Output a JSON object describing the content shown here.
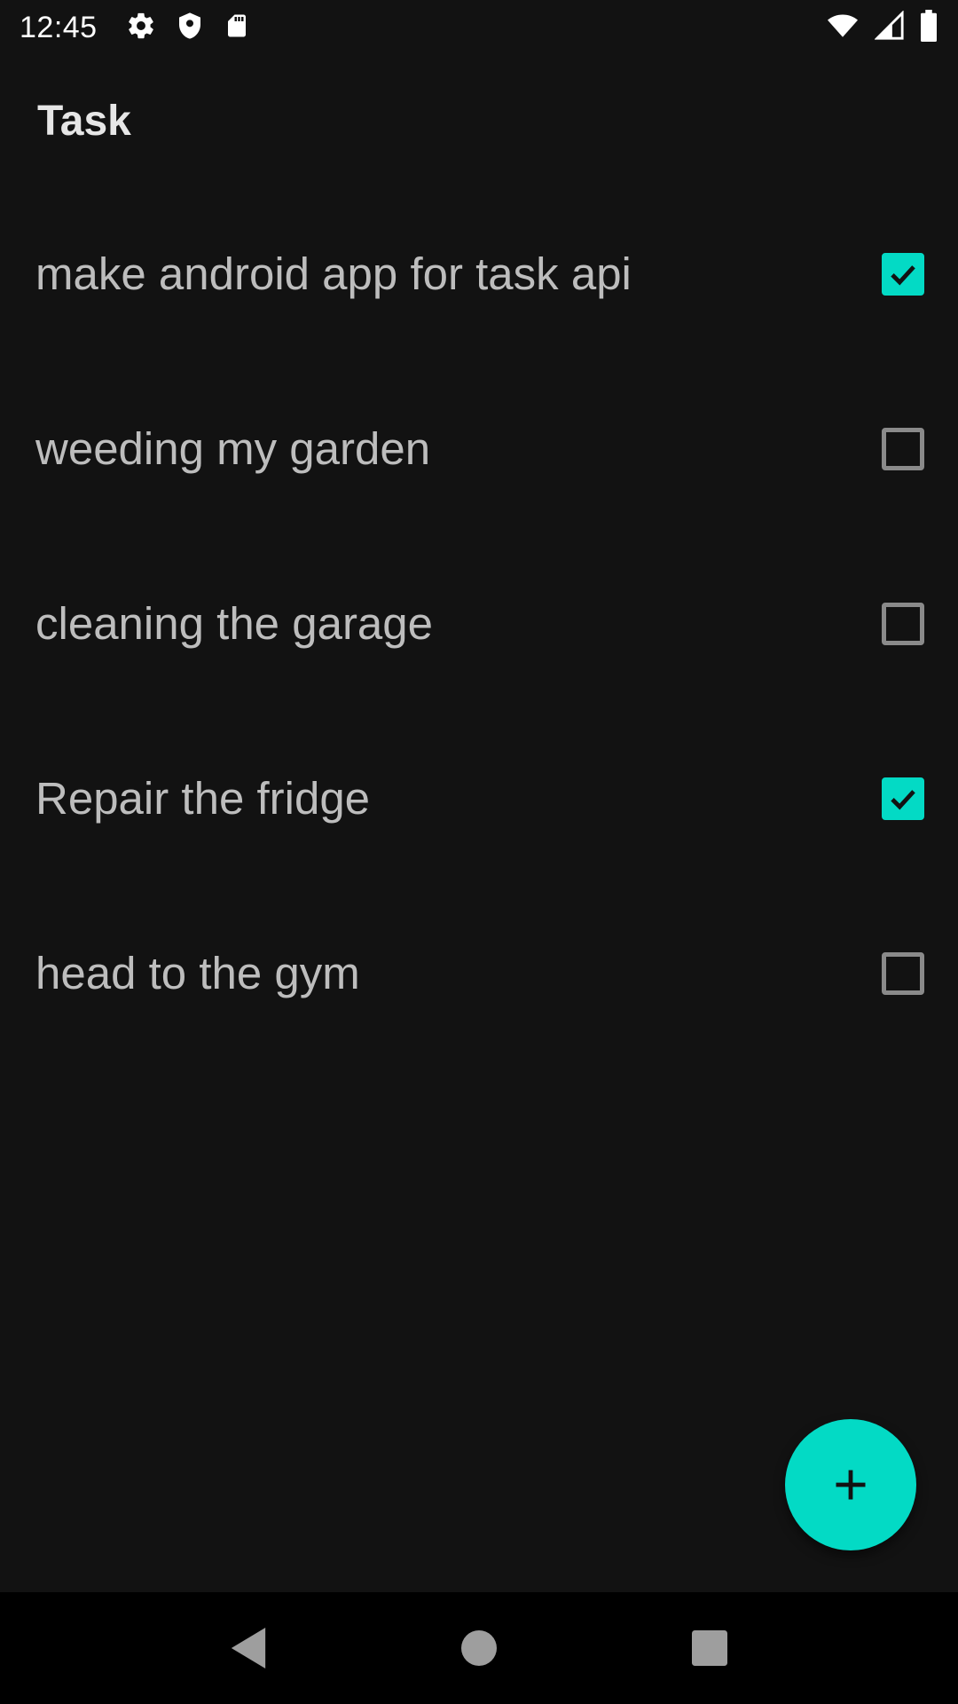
{
  "status_bar": {
    "time": "12:45",
    "left_icons": [
      "gear-icon",
      "shield-icon",
      "sd-card-icon"
    ],
    "right_icons": [
      "wifi-icon",
      "signal-icon",
      "battery-icon"
    ]
  },
  "app_bar": {
    "title": "Task"
  },
  "tasks": [
    {
      "label": "make android app for task api",
      "checked": true
    },
    {
      "label": "weeding my garden",
      "checked": false
    },
    {
      "label": "cleaning the garage",
      "checked": false
    },
    {
      "label": "Repair the fridge",
      "checked": true
    },
    {
      "label": "head to the gym",
      "checked": false
    }
  ],
  "fab": {
    "icon": "plus-icon"
  },
  "nav_bar": {
    "icons": [
      "back-icon",
      "home-icon",
      "recents-icon"
    ]
  },
  "colors": {
    "accent": "#03dac5",
    "background": "#121212"
  }
}
